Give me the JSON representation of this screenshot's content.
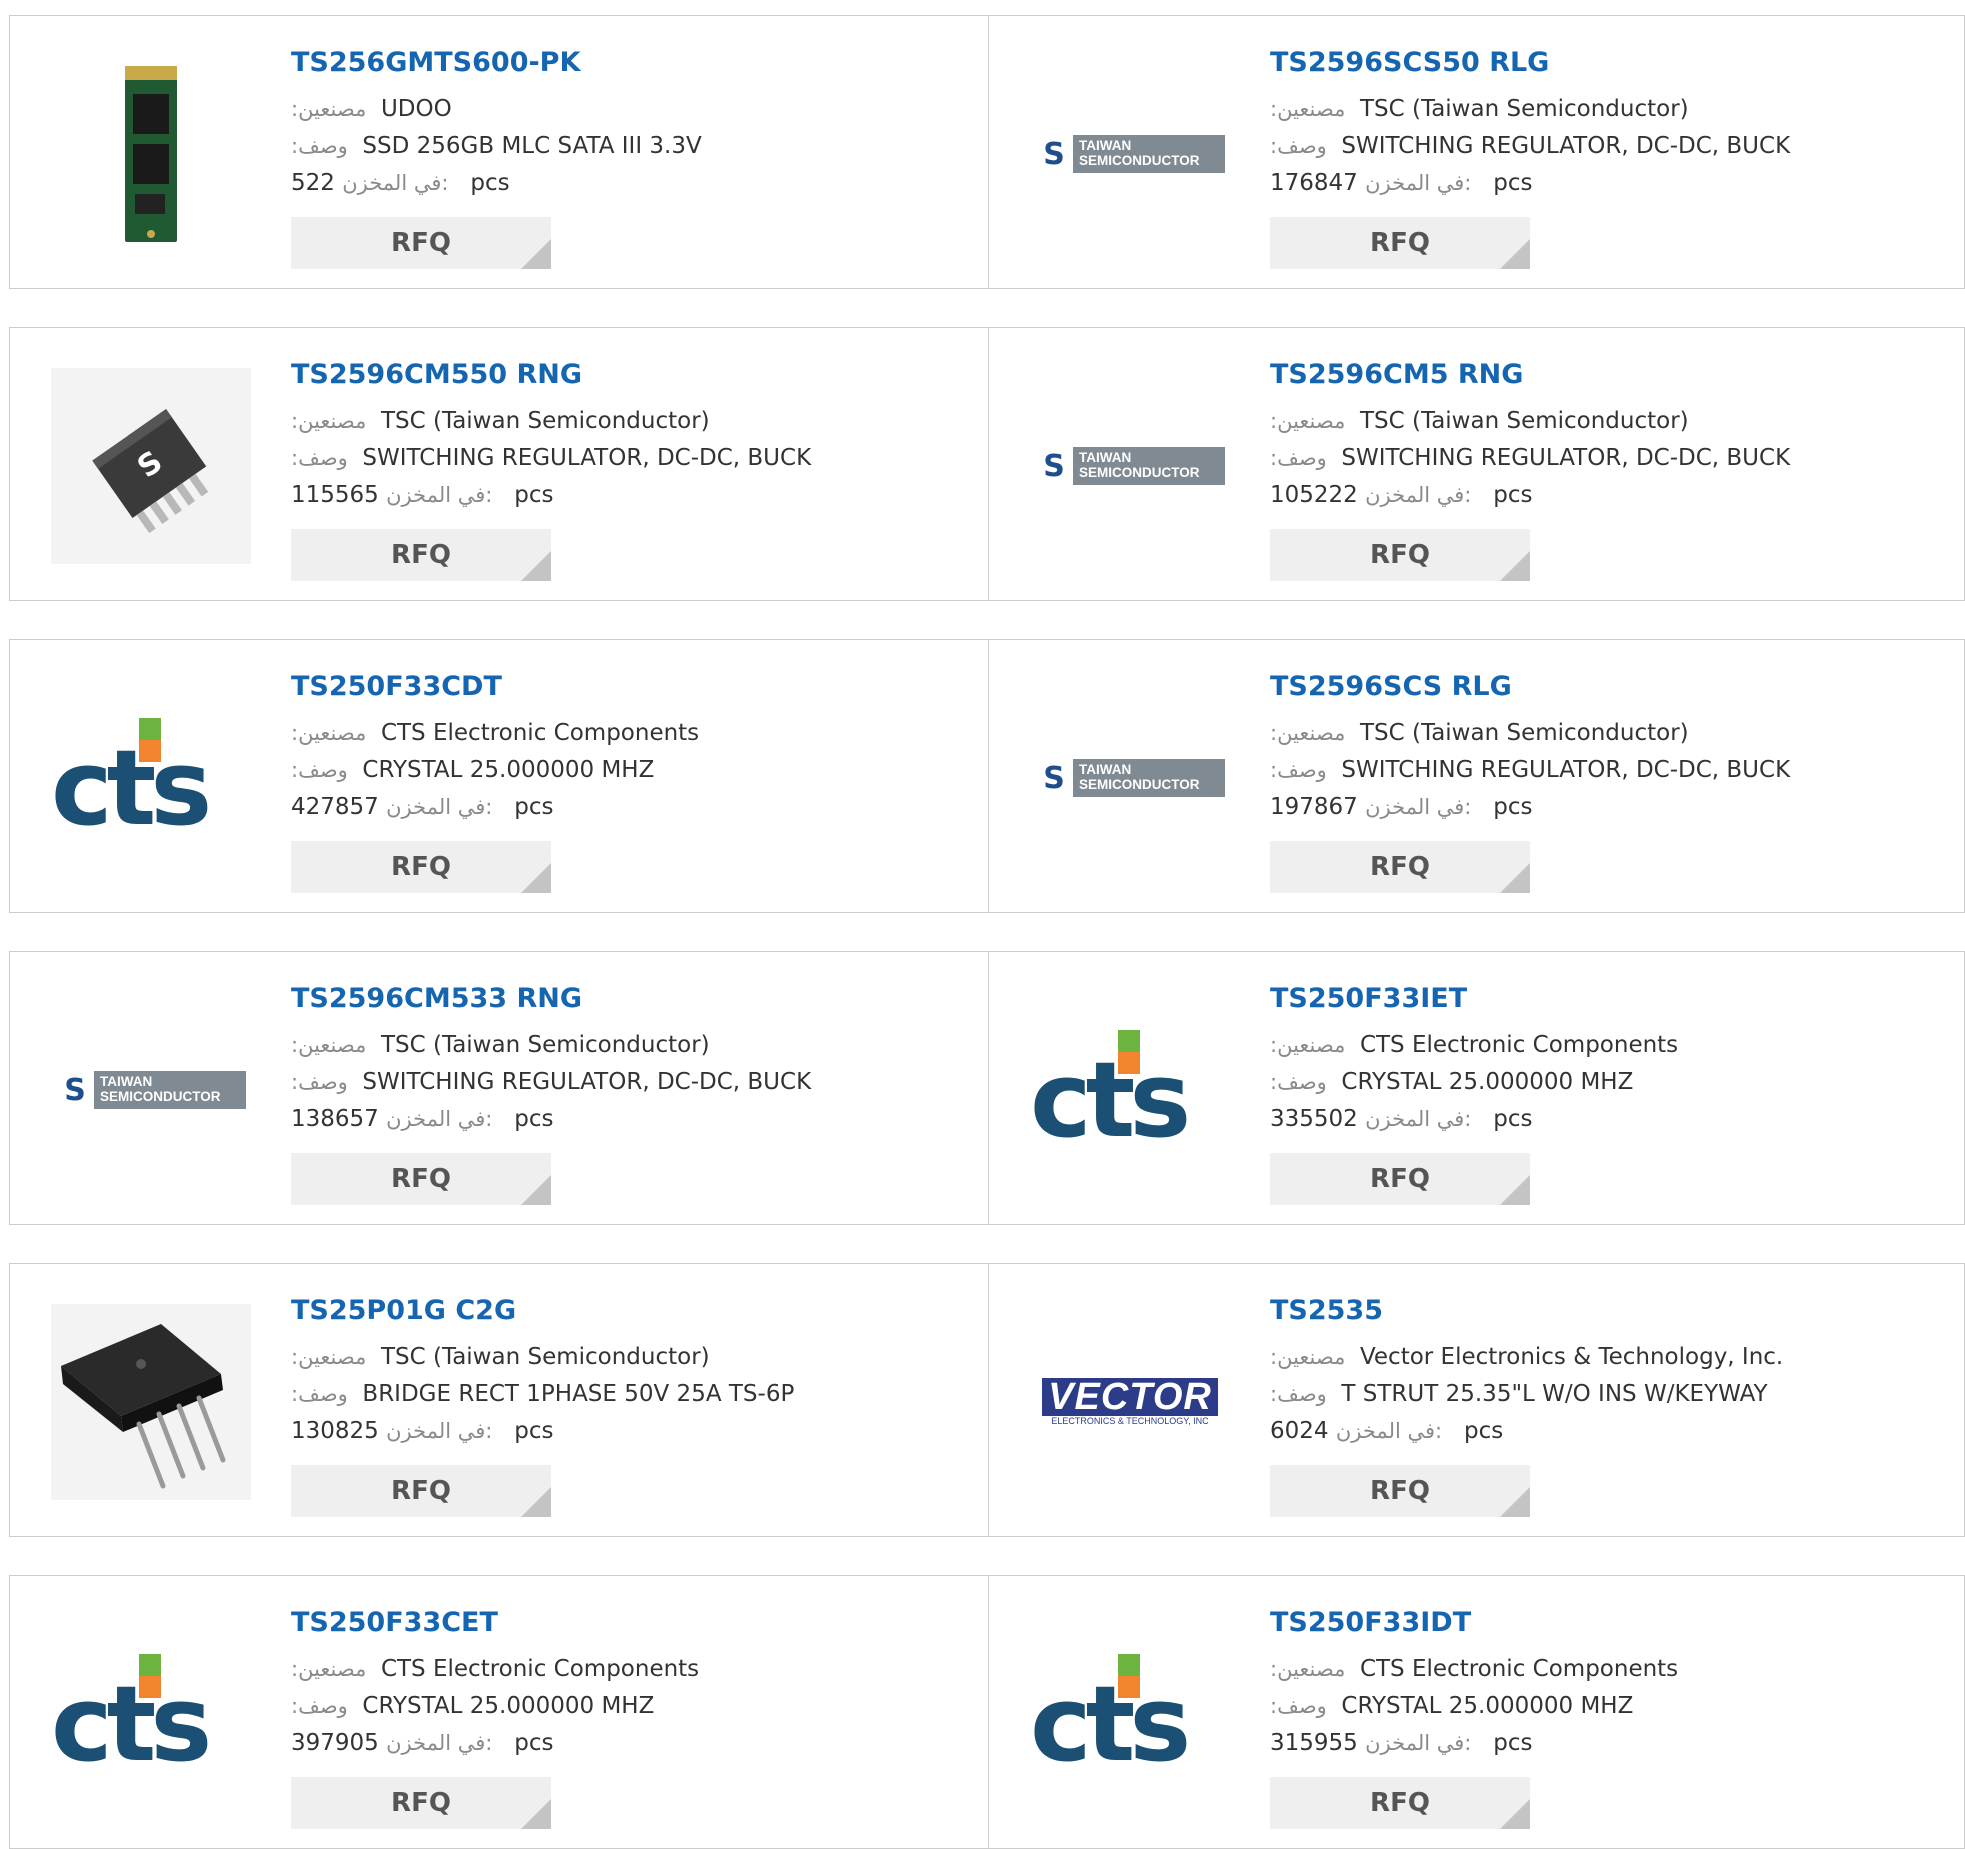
{
  "labels": {
    "manufacturer": ":مصنعين",
    "description": ":وصف",
    "stock": "في المخزن:",
    "unit": "pcs",
    "rfq": "RFQ"
  },
  "products": [
    {
      "part": "TS256GMTS600-PK",
      "manufacturer": "UDOO",
      "description": "SSD 256GB MLC SATA III 3.3V",
      "stock": "522",
      "image": "ssd-image"
    },
    {
      "part": "TS2596SCS50 RLG",
      "manufacturer": "TSC (Taiwan Semiconductor)",
      "description": "SWITCHING REGULATOR, DC-DC, BUCK",
      "stock": "176847",
      "image": "taiwan-semiconductor-logo"
    },
    {
      "part": "TS2596CM550 RNG",
      "manufacturer": "TSC (Taiwan Semiconductor)",
      "description": "SWITCHING REGULATOR, DC-DC, BUCK",
      "stock": "115565",
      "image": "chip-package-image"
    },
    {
      "part": "TS2596CM5 RNG",
      "manufacturer": "TSC (Taiwan Semiconductor)",
      "description": "SWITCHING REGULATOR, DC-DC, BUCK",
      "stock": "105222",
      "image": "taiwan-semiconductor-logo"
    },
    {
      "part": "TS250F33CDT",
      "manufacturer": "CTS Electronic Components",
      "description": "CRYSTAL 25.000000 MHZ",
      "stock": "427857",
      "image": "cts-logo"
    },
    {
      "part": "TS2596SCS RLG",
      "manufacturer": "TSC (Taiwan Semiconductor)",
      "description": "SWITCHING REGULATOR, DC-DC, BUCK",
      "stock": "197867",
      "image": "taiwan-semiconductor-logo"
    },
    {
      "part": "TS2596CM533 RNG",
      "manufacturer": "TSC (Taiwan Semiconductor)",
      "description": "SWITCHING REGULATOR, DC-DC, BUCK",
      "stock": "138657",
      "image": "taiwan-semiconductor-logo"
    },
    {
      "part": "TS250F33IET",
      "manufacturer": "CTS Electronic Components",
      "description": "CRYSTAL 25.000000 MHZ",
      "stock": "335502",
      "image": "cts-logo"
    },
    {
      "part": "TS25P01G C2G",
      "manufacturer": "TSC (Taiwan Semiconductor)",
      "description": "BRIDGE RECT 1PHASE 50V 25A TS-6P",
      "stock": "130825",
      "image": "bridge-rectifier-image"
    },
    {
      "part": "TS2535",
      "manufacturer": "Vector Electronics & Technology, Inc.",
      "description": "T STRUT 25.35\"L W/O INS W/KEYWAY",
      "stock": "6024",
      "image": "vector-logo"
    },
    {
      "part": "TS250F33CET",
      "manufacturer": "CTS Electronic Components",
      "description": "CRYSTAL 25.000000 MHZ",
      "stock": "397905",
      "image": "cts-logo"
    },
    {
      "part": "TS250F33IDT",
      "manufacturer": "CTS Electronic Components",
      "description": "CRYSTAL 25.000000 MHZ",
      "stock": "315955",
      "image": "cts-logo"
    }
  ],
  "logo_text": {
    "taiwan_mark": "S",
    "taiwan_line1": "TAIWAN",
    "taiwan_line2": "SEMICONDUCTOR",
    "cts": "cts",
    "vector": "VECTOR",
    "vector_sub": "ELECTRONICS & TECHNOLOGY, INC"
  },
  "colors": {
    "part_link": "#1565b0",
    "cts_blue": "#1b4f74",
    "cts_orange": "#f0852d",
    "cts_green": "#6cb33f",
    "taiwan_gray": "#7f8a93",
    "vector_blue": "#2d3c88"
  }
}
